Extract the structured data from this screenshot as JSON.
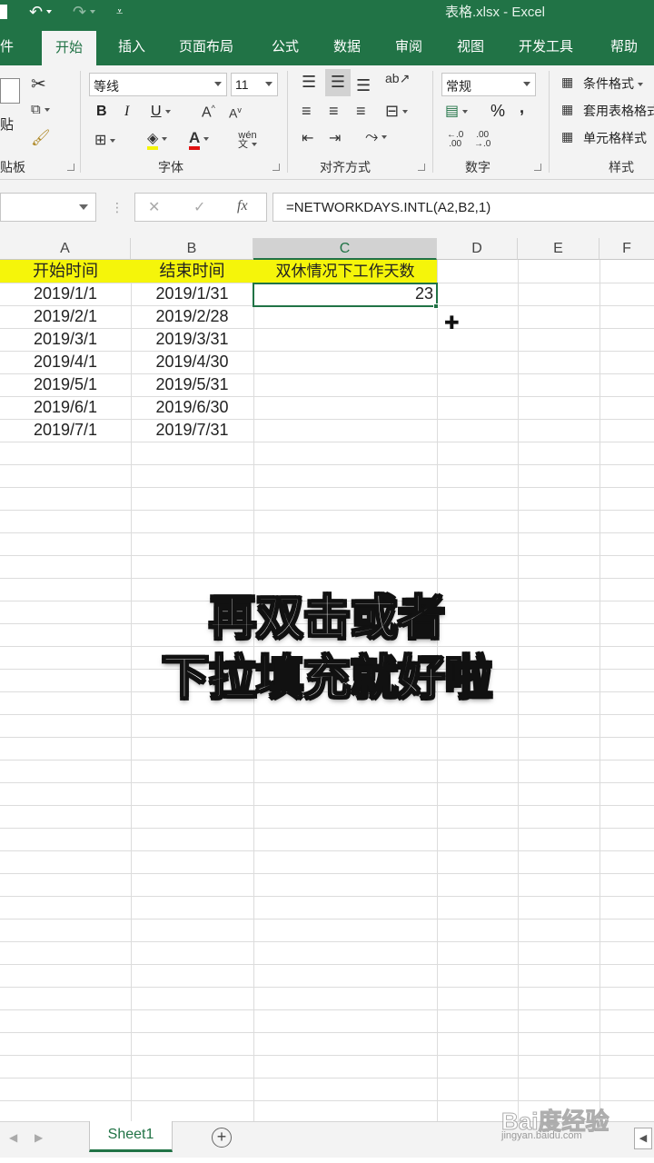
{
  "app": {
    "title": "表格.xlsx  -  Excel"
  },
  "qat": {
    "file_tab": "件"
  },
  "tabs": [
    "开始",
    "插入",
    "页面布局",
    "公式",
    "数据",
    "审阅",
    "视图",
    "开发工具",
    "帮助"
  ],
  "ribbon": {
    "clipboard": {
      "paste_label": "贴",
      "group_label": "剪贴板"
    },
    "font": {
      "name": "等线",
      "size": "11",
      "bold": "B",
      "italic": "I",
      "underline": "U",
      "group_label": "字体"
    },
    "alignment": {
      "group_label": "对齐方式"
    },
    "number": {
      "format": "常规",
      "percent": "%",
      "comma": ",",
      "group_label": "数字"
    },
    "styles": {
      "conditional": "条件格式",
      "table": "套用表格格式",
      "cell": "单元格样式",
      "group_label": "样式"
    }
  },
  "formula_bar": {
    "cancel": "✕",
    "enter": "✓",
    "fx": "fx",
    "formula": "=NETWORKDAYS.INTL(A2,B2,1)"
  },
  "columns": [
    "A",
    "B",
    "C",
    "D",
    "E",
    "F"
  ],
  "sheet": {
    "headers": [
      "开始时间",
      "结束时间",
      "双休情况下工作天数"
    ],
    "rows": [
      [
        "2019/1/1",
        "2019/1/31",
        "23"
      ],
      [
        "2019/2/1",
        "2019/2/28",
        ""
      ],
      [
        "2019/3/1",
        "2019/3/31",
        ""
      ],
      [
        "2019/4/1",
        "2019/4/30",
        ""
      ],
      [
        "2019/5/1",
        "2019/5/31",
        ""
      ],
      [
        "2019/6/1",
        "2019/6/30",
        ""
      ],
      [
        "2019/7/1",
        "2019/7/31",
        ""
      ]
    ]
  },
  "caption": {
    "line1": "再双击或者",
    "line2": "下拉填充就好啦"
  },
  "sheet_tabs": {
    "active": "Sheet1",
    "add": "+"
  },
  "watermark": {
    "brand": "Bai度经验",
    "url": "jingyan.baidu.com"
  },
  "colors": {
    "excel_green": "#217346",
    "header_fill": "#f5f50a"
  }
}
